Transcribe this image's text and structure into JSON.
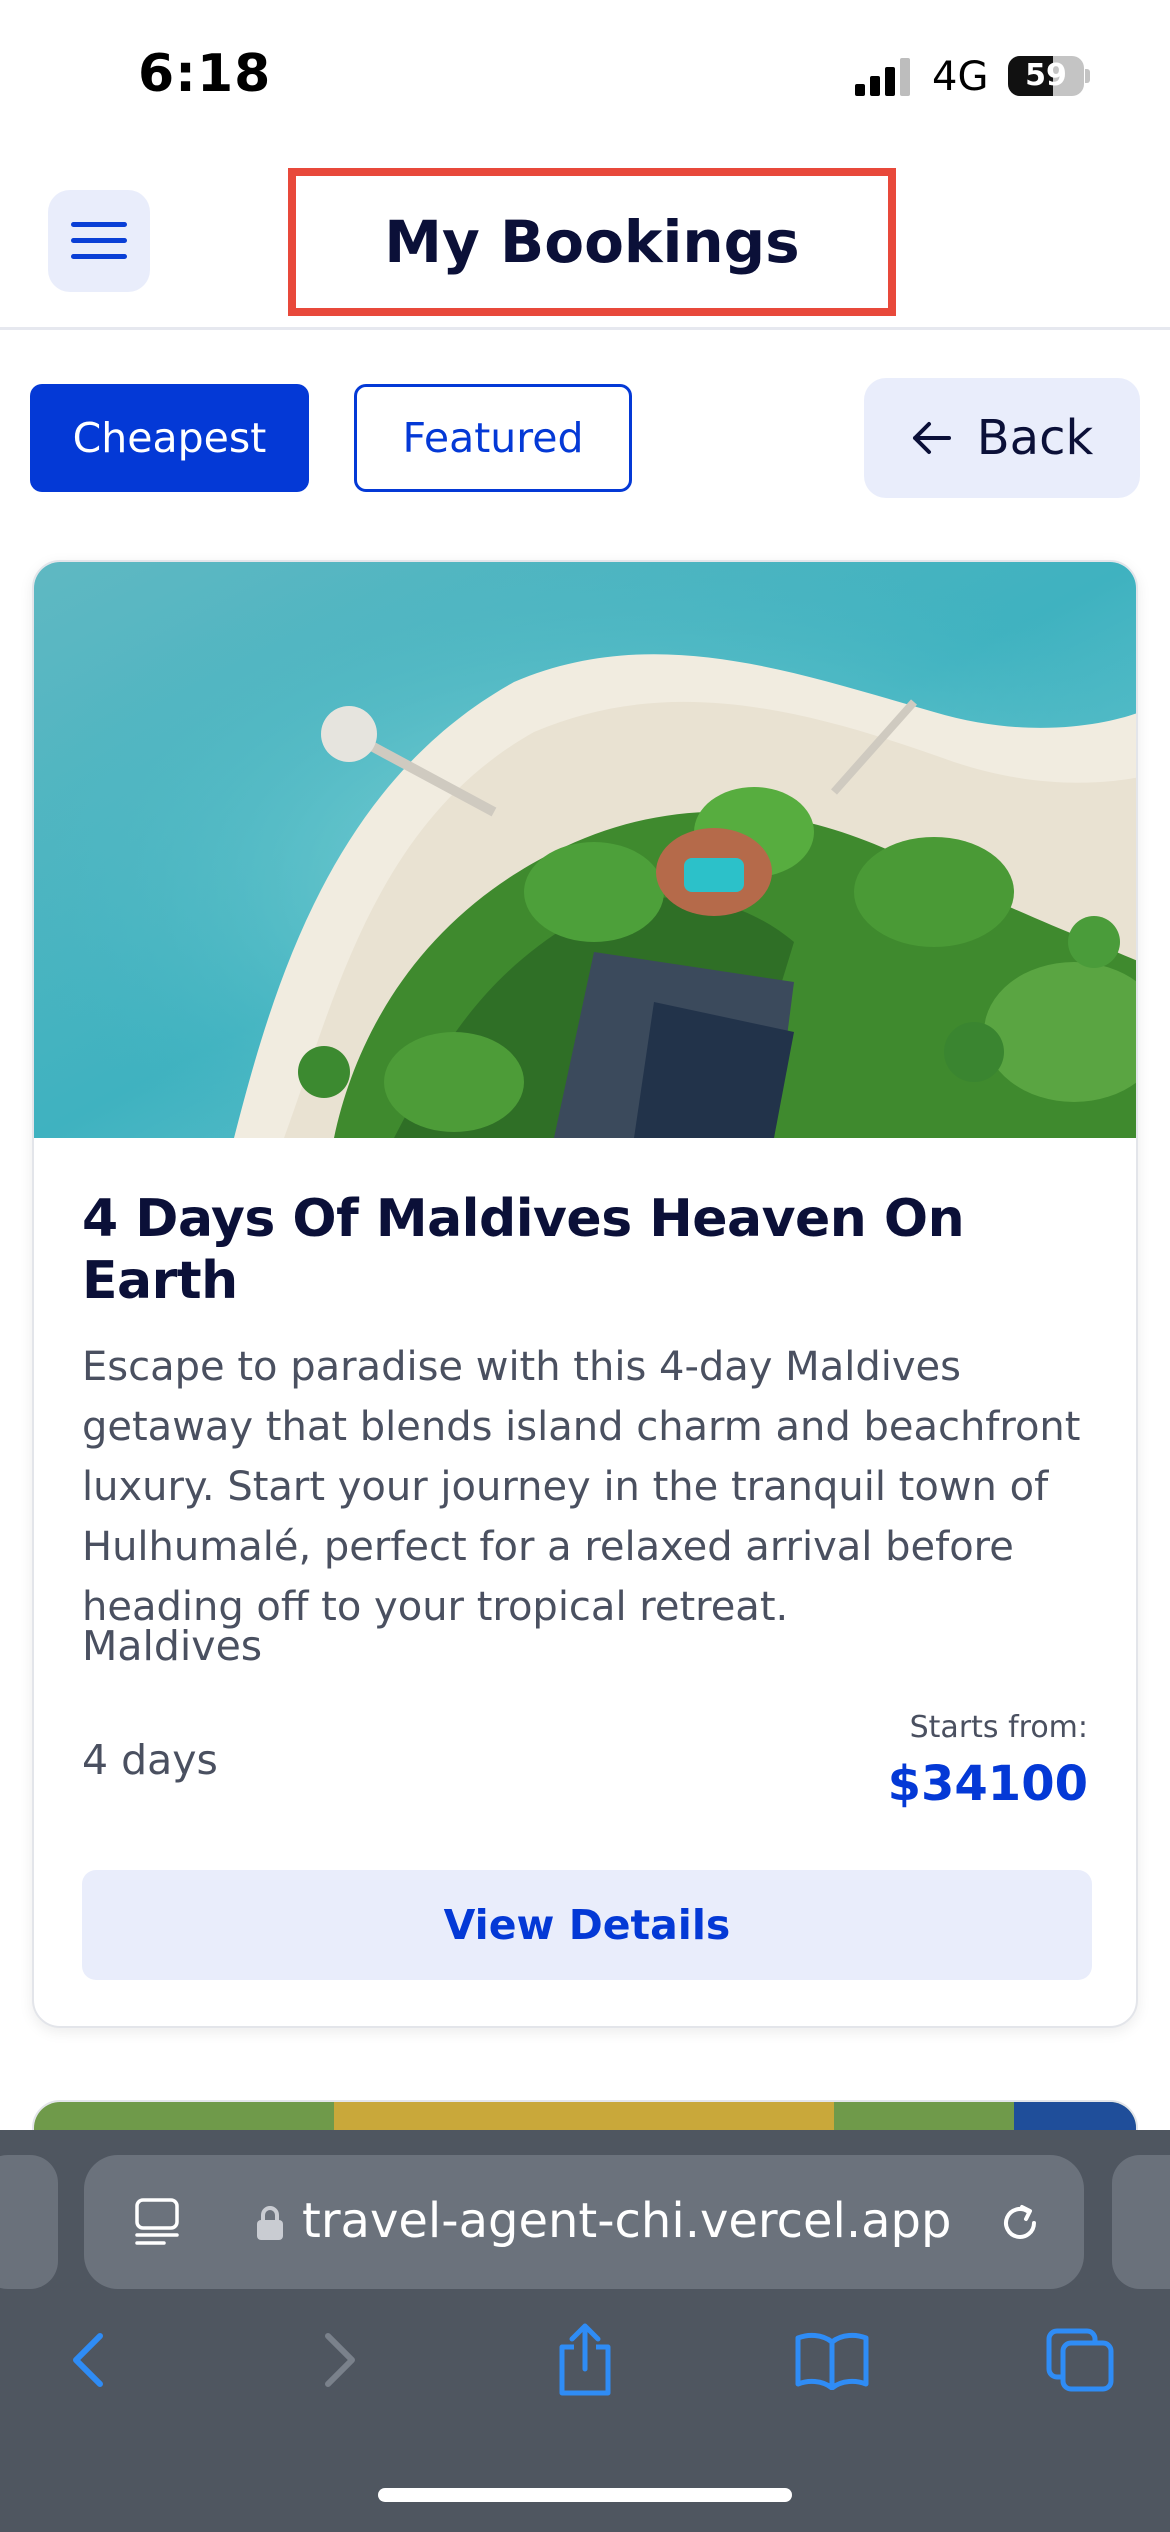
{
  "status_bar": {
    "time": "6:18",
    "network": "4G",
    "battery": "59",
    "battery_level": 0.59
  },
  "header": {
    "title": "My Bookings",
    "menu_icon": "hamburger-menu-icon",
    "highlight_color": "#e8493b"
  },
  "filters": {
    "cheapest_label": "Cheapest",
    "featured_label": "Featured",
    "back_label": "Back",
    "active": "Cheapest"
  },
  "booking": {
    "title": "4 Days Of Maldives Heaven On Earth",
    "description": "Escape to paradise with this 4-day Maldives getaway that blends island charm and beachfront luxury. Start your journey in the tranquil town of Hulhumalé, perfect for a relaxed arrival before heading off to your tropical retreat.",
    "location": "Maldives",
    "duration": "4 days",
    "price_label": "Starts from:",
    "price": "$34100",
    "details_label": "View Details",
    "image": "maldives-island-aerial-photo"
  },
  "browser": {
    "url": "travel-agent-chi.vercel.app",
    "icons": [
      "back-icon",
      "forward-icon",
      "share-icon",
      "bookmarks-icon",
      "tabs-icon"
    ]
  },
  "colors": {
    "accent": "#0439d6",
    "accent_light": "#e9edfb",
    "text_dark": "#0b1038",
    "text_muted": "#4a5060"
  }
}
